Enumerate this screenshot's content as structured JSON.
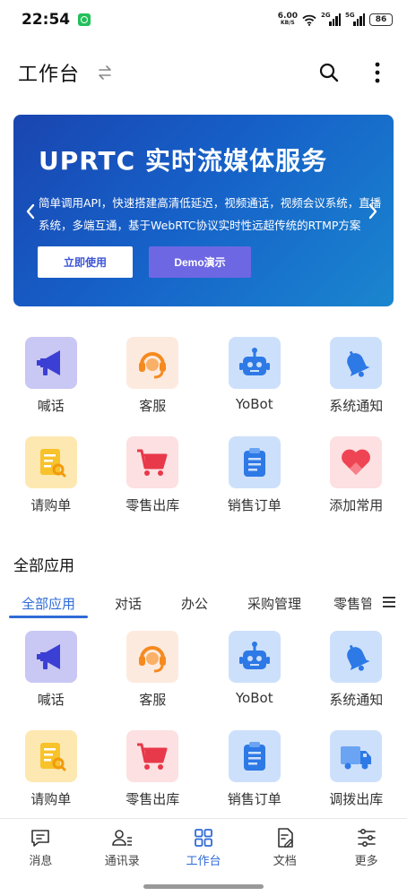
{
  "status_bar": {
    "time": "22:54",
    "net_speed_value": "6.00",
    "net_speed_unit": "KB/S",
    "signal1": "2G",
    "signal2": "5G",
    "battery": "86"
  },
  "header": {
    "title": "工作台"
  },
  "banner": {
    "title": "UPRTC 实时流媒体服务",
    "description": "简单调用API，快速搭建高清低延迟，视频通话，视频会议系统，直播系统，多端互通，基于WebRTC协议实时性远超传统的RTMP方案",
    "primary_button": "立即使用",
    "demo_button": "Demo演示"
  },
  "quick_apps": [
    {
      "label": "喊话",
      "icon": "megaphone-icon"
    },
    {
      "label": "客服",
      "icon": "headset-icon"
    },
    {
      "label": "YoBot",
      "icon": "robot-icon"
    },
    {
      "label": "系统通知",
      "icon": "bell-icon"
    },
    {
      "label": "请购单",
      "icon": "requisition-doc-icon"
    },
    {
      "label": "零售出库",
      "icon": "shopping-cart-icon"
    },
    {
      "label": "销售订单",
      "icon": "clipboard-icon"
    },
    {
      "label": "添加常用",
      "icon": "heart-icon"
    }
  ],
  "all_apps": {
    "title": "全部应用",
    "tabs": [
      "全部应用",
      "对话",
      "办公",
      "采购管理",
      "零售管理"
    ],
    "active_tab": 0,
    "items": [
      {
        "label": "喊话",
        "icon": "megaphone-icon"
      },
      {
        "label": "客服",
        "icon": "headset-icon"
      },
      {
        "label": "YoBot",
        "icon": "robot-icon"
      },
      {
        "label": "系统通知",
        "icon": "bell-icon"
      },
      {
        "label": "请购单",
        "icon": "requisition-doc-icon"
      },
      {
        "label": "零售出库",
        "icon": "shopping-cart-icon"
      },
      {
        "label": "销售订单",
        "icon": "clipboard-icon"
      },
      {
        "label": "调拨出库",
        "icon": "truck-icon"
      }
    ]
  },
  "bottom_nav": {
    "items": [
      {
        "label": "消息",
        "icon": "message-icon"
      },
      {
        "label": "通讯录",
        "icon": "contacts-icon"
      },
      {
        "label": "工作台",
        "icon": "workbench-grid-icon"
      },
      {
        "label": "文档",
        "icon": "document-icon"
      },
      {
        "label": "更多",
        "icon": "settings-sliders-icon"
      }
    ],
    "active_index": 2
  },
  "colors": {
    "accent": "#2f6bd6",
    "banner_start": "#1a45b0",
    "banner_end": "#1a86cf",
    "demo_button": "#6e67e3"
  }
}
